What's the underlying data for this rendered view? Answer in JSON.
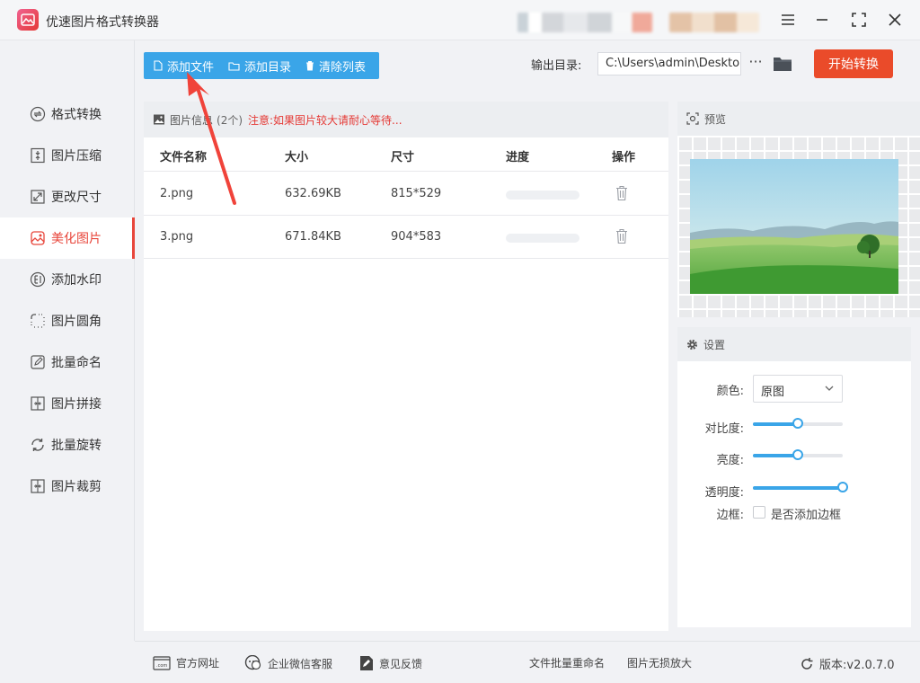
{
  "app": {
    "title": "优速图片格式转换器"
  },
  "sidebar": {
    "items": [
      {
        "label": "格式转换",
        "icon": "format-convert-icon"
      },
      {
        "label": "图片压缩",
        "icon": "compress-icon"
      },
      {
        "label": "更改尺寸",
        "icon": "resize-icon"
      },
      {
        "label": "美化图片",
        "icon": "beautify-icon",
        "active": true
      },
      {
        "label": "添加水印",
        "icon": "watermark-icon"
      },
      {
        "label": "图片圆角",
        "icon": "round-corner-icon"
      },
      {
        "label": "批量命名",
        "icon": "rename-icon"
      },
      {
        "label": "图片拼接",
        "icon": "stitch-icon"
      },
      {
        "label": "批量旋转",
        "icon": "rotate-icon"
      },
      {
        "label": "图片裁剪",
        "icon": "crop-icon"
      }
    ]
  },
  "toolbar": {
    "add_file": "添加文件",
    "add_dir": "添加目录",
    "clear_list": "清除列表",
    "output_label": "输出目录:",
    "output_path": "C:\\Users\\admin\\Desktop",
    "more": "···",
    "start": "开始转换"
  },
  "filepanel": {
    "title": "图片信息",
    "count": "(2个)",
    "note": "注意:如果图片较大请耐心等待...",
    "columns": [
      "文件名称",
      "大小",
      "尺寸",
      "进度",
      "操作"
    ],
    "rows": [
      {
        "name": "2.png",
        "size": "632.69KB",
        "dims": "815*529",
        "progress": 0
      },
      {
        "name": "3.png",
        "size": "671.84KB",
        "dims": "904*583",
        "progress": 0
      }
    ]
  },
  "preview": {
    "title": "预览"
  },
  "settings": {
    "title": "设置",
    "color_label": "颜色:",
    "color_value": "原图",
    "contrast_label": "对比度:",
    "contrast": 0.5,
    "brightness_label": "亮度:",
    "brightness": 0.5,
    "opacity_label": "透明度:",
    "opacity": 1.0,
    "border_label": "边框:",
    "border_checkbox": "是否添加边框",
    "border_checked": false
  },
  "footer": {
    "website": "官方网址",
    "wechat": "企业微信客服",
    "feedback": "意见反馈",
    "batch_rename": "文件批量重命名",
    "upscale": "图片无损放大",
    "version": "版本:v2.0.7.0"
  },
  "colors": {
    "accent": "#3aa5e8",
    "active": "#e8463b",
    "start": "#ea4b2a"
  }
}
